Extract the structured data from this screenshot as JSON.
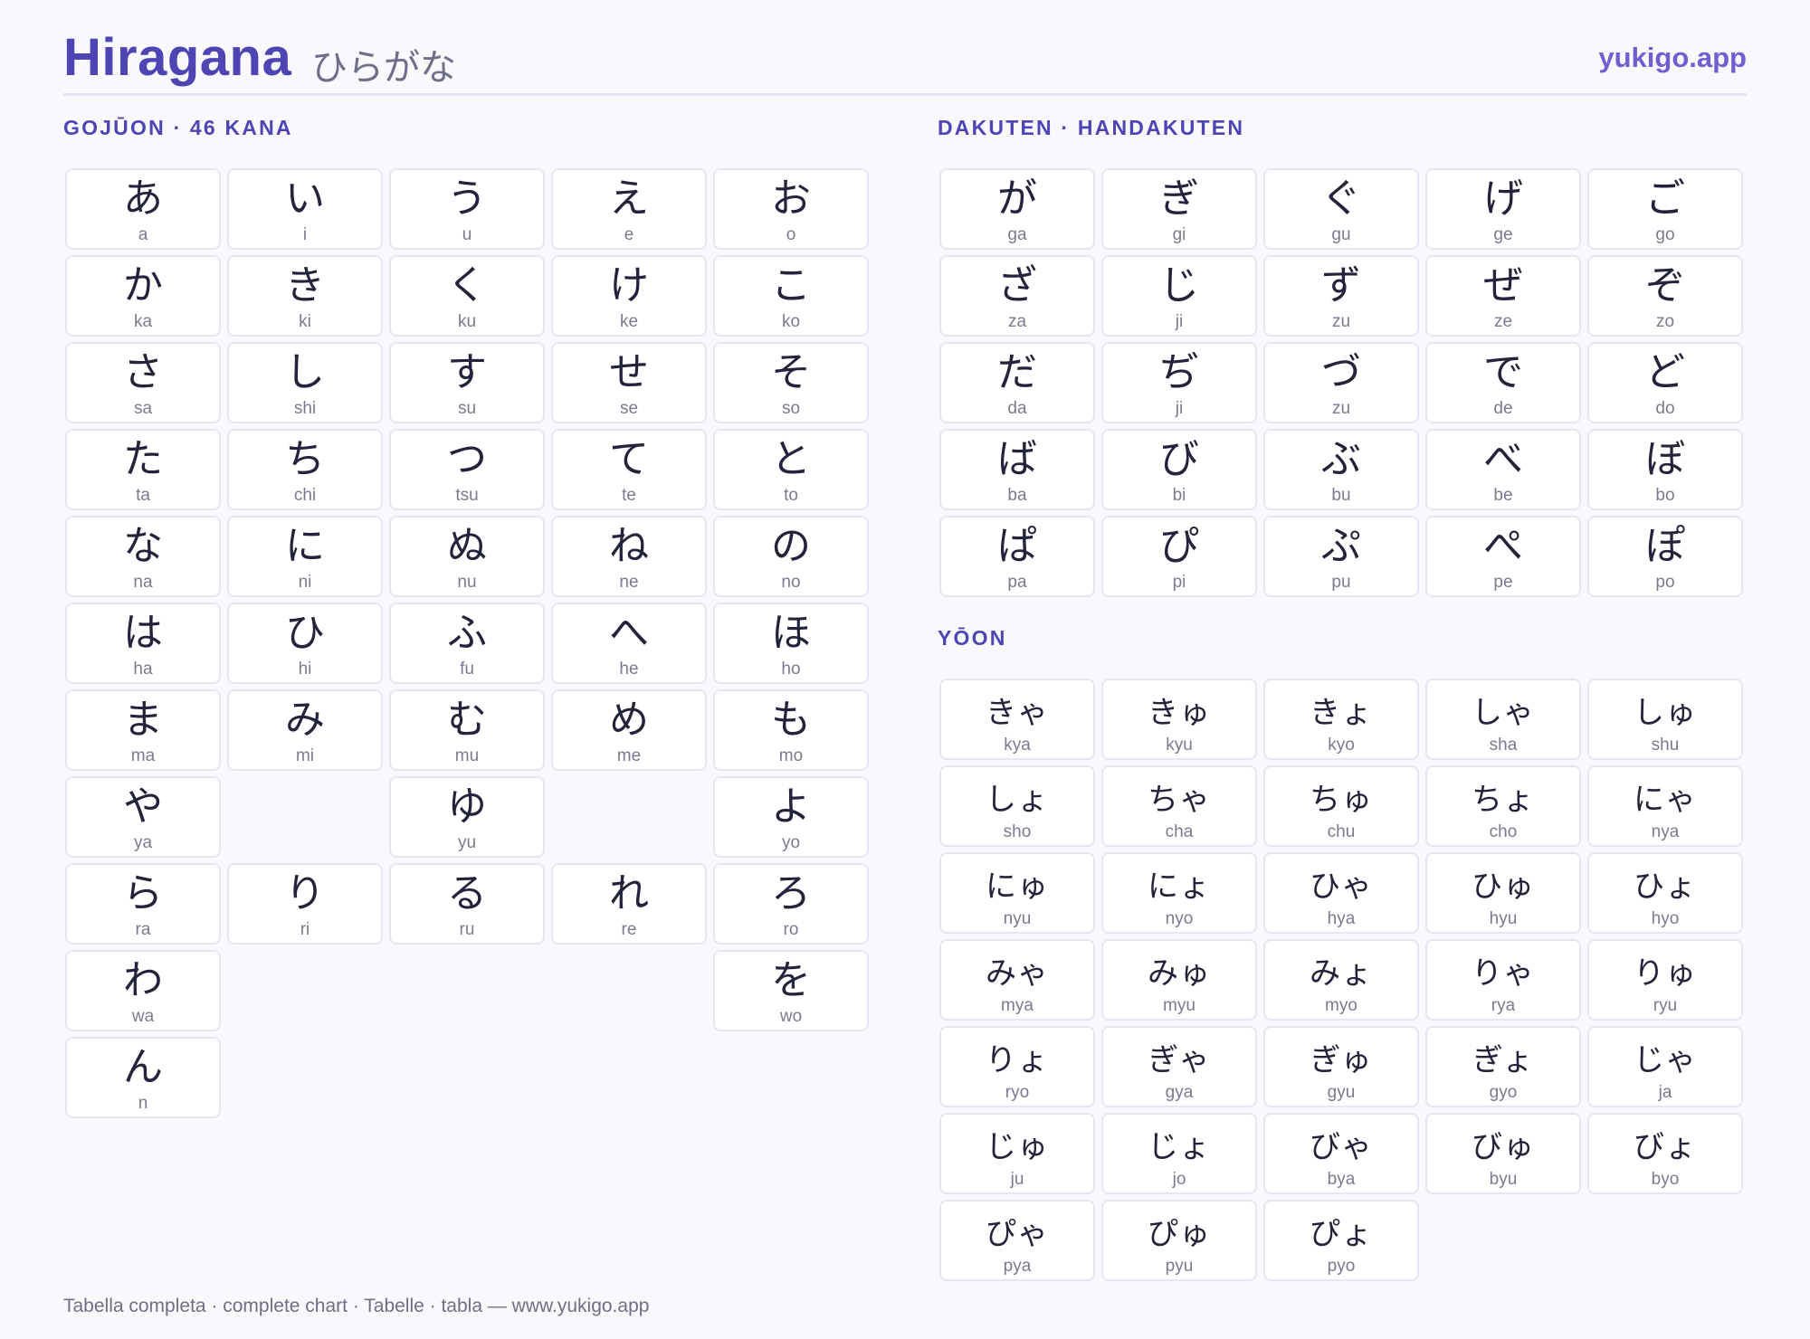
{
  "header": {
    "title": "Hiragana",
    "subtitle": "ひらがな",
    "site": "yukigo.app"
  },
  "gojuon": {
    "heading": "GOJŪON · 46 KANA",
    "rows": [
      [
        {
          "k": "あ",
          "r": "a"
        },
        {
          "k": "い",
          "r": "i"
        },
        {
          "k": "う",
          "r": "u"
        },
        {
          "k": "え",
          "r": "e"
        },
        {
          "k": "お",
          "r": "o"
        }
      ],
      [
        {
          "k": "か",
          "r": "ka"
        },
        {
          "k": "き",
          "r": "ki"
        },
        {
          "k": "く",
          "r": "ku"
        },
        {
          "k": "け",
          "r": "ke"
        },
        {
          "k": "こ",
          "r": "ko"
        }
      ],
      [
        {
          "k": "さ",
          "r": "sa"
        },
        {
          "k": "し",
          "r": "shi"
        },
        {
          "k": "す",
          "r": "su"
        },
        {
          "k": "せ",
          "r": "se"
        },
        {
          "k": "そ",
          "r": "so"
        }
      ],
      [
        {
          "k": "た",
          "r": "ta"
        },
        {
          "k": "ち",
          "r": "chi"
        },
        {
          "k": "つ",
          "r": "tsu"
        },
        {
          "k": "て",
          "r": "te"
        },
        {
          "k": "と",
          "r": "to"
        }
      ],
      [
        {
          "k": "な",
          "r": "na"
        },
        {
          "k": "に",
          "r": "ni"
        },
        {
          "k": "ぬ",
          "r": "nu"
        },
        {
          "k": "ね",
          "r": "ne"
        },
        {
          "k": "の",
          "r": "no"
        }
      ],
      [
        {
          "k": "は",
          "r": "ha"
        },
        {
          "k": "ひ",
          "r": "hi"
        },
        {
          "k": "ふ",
          "r": "fu"
        },
        {
          "k": "へ",
          "r": "he"
        },
        {
          "k": "ほ",
          "r": "ho"
        }
      ],
      [
        {
          "k": "ま",
          "r": "ma"
        },
        {
          "k": "み",
          "r": "mi"
        },
        {
          "k": "む",
          "r": "mu"
        },
        {
          "k": "め",
          "r": "me"
        },
        {
          "k": "も",
          "r": "mo"
        }
      ],
      [
        {
          "k": "や",
          "r": "ya"
        },
        null,
        {
          "k": "ゆ",
          "r": "yu"
        },
        null,
        {
          "k": "よ",
          "r": "yo"
        }
      ],
      [
        {
          "k": "ら",
          "r": "ra"
        },
        {
          "k": "り",
          "r": "ri"
        },
        {
          "k": "る",
          "r": "ru"
        },
        {
          "k": "れ",
          "r": "re"
        },
        {
          "k": "ろ",
          "r": "ro"
        }
      ],
      [
        {
          "k": "わ",
          "r": "wa"
        },
        null,
        null,
        null,
        {
          "k": "を",
          "r": "wo"
        }
      ],
      [
        {
          "k": "ん",
          "r": "n"
        },
        null,
        null,
        null,
        null
      ]
    ]
  },
  "dakuten": {
    "heading": "DAKUTEN · HANDAKUTEN",
    "rows": [
      [
        {
          "k": "が",
          "r": "ga"
        },
        {
          "k": "ぎ",
          "r": "gi"
        },
        {
          "k": "ぐ",
          "r": "gu"
        },
        {
          "k": "げ",
          "r": "ge"
        },
        {
          "k": "ご",
          "r": "go"
        }
      ],
      [
        {
          "k": "ざ",
          "r": "za"
        },
        {
          "k": "じ",
          "r": "ji"
        },
        {
          "k": "ず",
          "r": "zu"
        },
        {
          "k": "ぜ",
          "r": "ze"
        },
        {
          "k": "ぞ",
          "r": "zo"
        }
      ],
      [
        {
          "k": "だ",
          "r": "da"
        },
        {
          "k": "ぢ",
          "r": "ji"
        },
        {
          "k": "づ",
          "r": "zu"
        },
        {
          "k": "で",
          "r": "de"
        },
        {
          "k": "ど",
          "r": "do"
        }
      ],
      [
        {
          "k": "ば",
          "r": "ba"
        },
        {
          "k": "び",
          "r": "bi"
        },
        {
          "k": "ぶ",
          "r": "bu"
        },
        {
          "k": "べ",
          "r": "be"
        },
        {
          "k": "ぼ",
          "r": "bo"
        }
      ],
      [
        {
          "k": "ぱ",
          "r": "pa"
        },
        {
          "k": "ぴ",
          "r": "pi"
        },
        {
          "k": "ぷ",
          "r": "pu"
        },
        {
          "k": "ぺ",
          "r": "pe"
        },
        {
          "k": "ぽ",
          "r": "po"
        }
      ]
    ]
  },
  "yoon": {
    "heading": "YŌON",
    "rows": [
      [
        {
          "k": "きゃ",
          "r": "kya"
        },
        {
          "k": "きゅ",
          "r": "kyu"
        },
        {
          "k": "きょ",
          "r": "kyo"
        },
        {
          "k": "しゃ",
          "r": "sha"
        },
        {
          "k": "しゅ",
          "r": "shu"
        }
      ],
      [
        {
          "k": "しょ",
          "r": "sho"
        },
        {
          "k": "ちゃ",
          "r": "cha"
        },
        {
          "k": "ちゅ",
          "r": "chu"
        },
        {
          "k": "ちょ",
          "r": "cho"
        },
        {
          "k": "にゃ",
          "r": "nya"
        }
      ],
      [
        {
          "k": "にゅ",
          "r": "nyu"
        },
        {
          "k": "にょ",
          "r": "nyo"
        },
        {
          "k": "ひゃ",
          "r": "hya"
        },
        {
          "k": "ひゅ",
          "r": "hyu"
        },
        {
          "k": "ひょ",
          "r": "hyo"
        }
      ],
      [
        {
          "k": "みゃ",
          "r": "mya"
        },
        {
          "k": "みゅ",
          "r": "myu"
        },
        {
          "k": "みょ",
          "r": "myo"
        },
        {
          "k": "りゃ",
          "r": "rya"
        },
        {
          "k": "りゅ",
          "r": "ryu"
        }
      ],
      [
        {
          "k": "りょ",
          "r": "ryo"
        },
        {
          "k": "ぎゃ",
          "r": "gya"
        },
        {
          "k": "ぎゅ",
          "r": "gyu"
        },
        {
          "k": "ぎょ",
          "r": "gyo"
        },
        {
          "k": "じゃ",
          "r": "ja"
        }
      ],
      [
        {
          "k": "じゅ",
          "r": "ju"
        },
        {
          "k": "じょ",
          "r": "jo"
        },
        {
          "k": "びゃ",
          "r": "bya"
        },
        {
          "k": "びゅ",
          "r": "byu"
        },
        {
          "k": "びょ",
          "r": "byo"
        }
      ],
      [
        {
          "k": "ぴゃ",
          "r": "pya"
        },
        {
          "k": "ぴゅ",
          "r": "pyu"
        },
        {
          "k": "ぴょ",
          "r": "pyo"
        },
        null,
        null
      ]
    ]
  },
  "footer": {
    "text": "Tabella completa · complete chart · Tabelle · tabla — www.yukigo.app"
  }
}
